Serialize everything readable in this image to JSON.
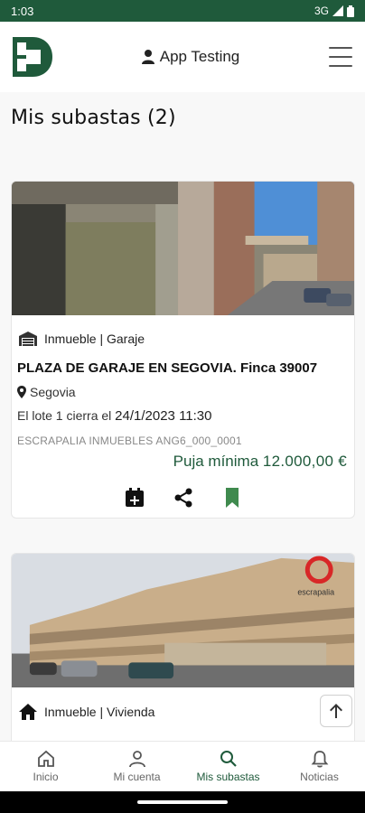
{
  "status_bar": {
    "time": "1:03",
    "network": "3G"
  },
  "header": {
    "user_label": "App Testing"
  },
  "page": {
    "title": "Mis subastas (2)"
  },
  "cards": [
    {
      "category": "Inmueble | Garaje",
      "title": "PLAZA DE GARAJE EN SEGOVIA. Finca 39007",
      "location": "Segovia",
      "close_prefix": "El lote 1  cierra el",
      "close_date": "24/1/2023 11:30",
      "meta": "ESCRAPALIA INMUEBLES   ANG6_000_0001",
      "price_label": "Puja mínima",
      "price_amount": "12.000,00 €"
    },
    {
      "category": "Inmueble | Vivienda",
      "watermark": "escrapalia"
    }
  ],
  "bottom_nav": [
    {
      "label": "Inicio",
      "icon": "home-icon"
    },
    {
      "label": "Mi cuenta",
      "icon": "person-icon"
    },
    {
      "label": "Mis subastas",
      "icon": "search-icon"
    },
    {
      "label": "Noticias",
      "icon": "bell-icon"
    }
  ],
  "colors": {
    "brand": "#1f5a3b",
    "status_bar": "#1f5a3b",
    "bookmark": "#3f8a4e"
  }
}
